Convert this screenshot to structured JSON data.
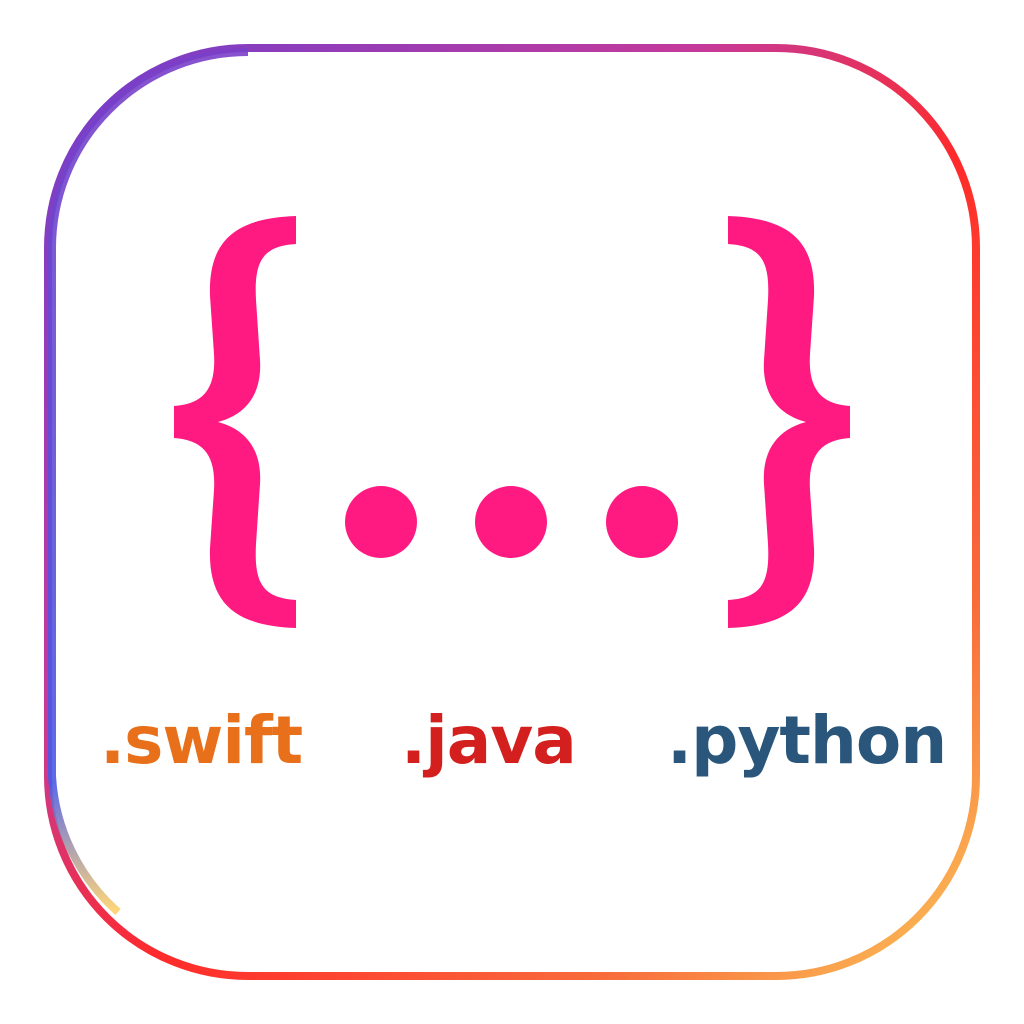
{
  "colors": {
    "brace": "#FF1A82",
    "dots": "#FF1A82",
    "border_gradient": [
      "#8A3FC8",
      "#C53A9A",
      "#FF2A2A",
      "#F86C3B",
      "#FBC95A",
      "#FFE07A",
      "#4A5AE6",
      "#6C3FCF"
    ],
    "swift": "#E8701A",
    "java": "#D41F1F",
    "python": "#29567A"
  },
  "symbol": {
    "open_brace_glyph": "{",
    "close_brace_glyph": "}",
    "dots_count": 3
  },
  "labels": {
    "swift": ".swift",
    "java": ".java",
    "python": ".python"
  }
}
